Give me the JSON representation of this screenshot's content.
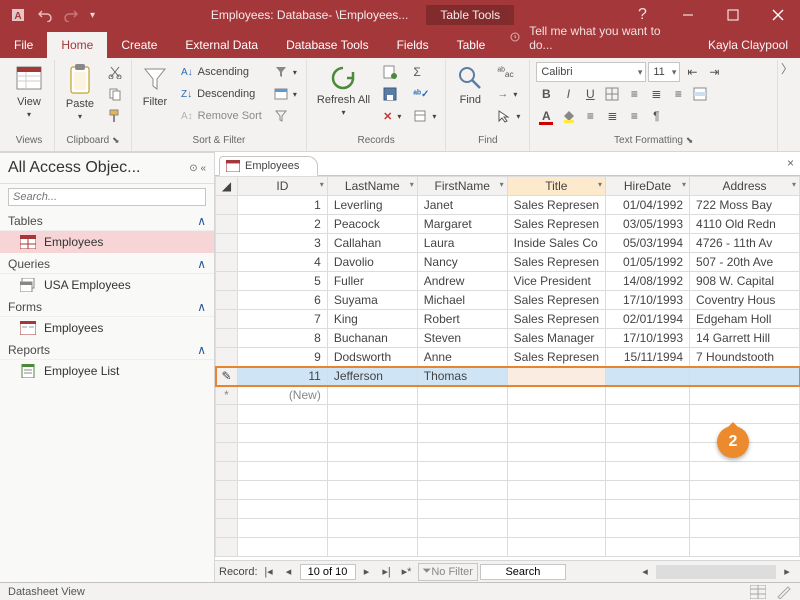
{
  "titlebar": {
    "title": "Employees: Database- \\Employees...",
    "tools_label": "Table Tools",
    "user": "Kayla Claypool"
  },
  "ribbon_tabs": [
    "File",
    "Home",
    "Create",
    "External Data",
    "Database Tools",
    "Fields",
    "Table"
  ],
  "tell_me": "Tell me what you want to do...",
  "groups": {
    "views": "Views",
    "clipboard": "Clipboard",
    "sort_filter": "Sort & Filter",
    "records": "Records",
    "find": "Find",
    "text_formatting": "Text Formatting",
    "view": "View",
    "paste": "Paste",
    "filter": "Filter",
    "ascending": "Ascending",
    "descending": "Descending",
    "remove_sort": "Remove Sort",
    "refresh": "Refresh All",
    "find_btn": "Find"
  },
  "font": {
    "name": "Calibri",
    "size": "11"
  },
  "nav": {
    "title": "All Access Objec...",
    "search_placeholder": "Search...",
    "sections": {
      "tables": "Tables",
      "queries": "Queries",
      "forms": "Forms",
      "reports": "Reports"
    },
    "items": {
      "table_employees": "Employees",
      "query_usa": "USA Employees",
      "form_employees": "Employees",
      "report_list": "Employee List"
    }
  },
  "tab_label": "Employees",
  "columns": {
    "id": "ID",
    "last": "LastName",
    "first": "FirstName",
    "title": "Title",
    "hire": "HireDate",
    "addr": "Address"
  },
  "rows": [
    {
      "id": "1",
      "last": "Leverling",
      "first": "Janet",
      "title": "Sales Represen",
      "hire": "01/04/1992",
      "addr": "722 Moss Bay"
    },
    {
      "id": "2",
      "last": "Peacock",
      "first": "Margaret",
      "title": "Sales Represen",
      "hire": "03/05/1993",
      "addr": "4110 Old Redn"
    },
    {
      "id": "3",
      "last": "Callahan",
      "first": "Laura",
      "title": "Inside Sales Co",
      "hire": "05/03/1994",
      "addr": "4726 - 11th Av"
    },
    {
      "id": "4",
      "last": "Davolio",
      "first": "Nancy",
      "title": "Sales Represen",
      "hire": "01/05/1992",
      "addr": "507 - 20th Ave"
    },
    {
      "id": "5",
      "last": "Fuller",
      "first": "Andrew",
      "title": "Vice President",
      "hire": "14/08/1992",
      "addr": "908 W. Capital"
    },
    {
      "id": "6",
      "last": "Suyama",
      "first": "Michael",
      "title": "Sales Represen",
      "hire": "17/10/1993",
      "addr": "Coventry Hous"
    },
    {
      "id": "7",
      "last": "King",
      "first": "Robert",
      "title": "Sales Represen",
      "hire": "02/01/1994",
      "addr": "Edgeham Holl"
    },
    {
      "id": "8",
      "last": "Buchanan",
      "first": "Steven",
      "title": "Sales Manager",
      "hire": "17/10/1993",
      "addr": "14 Garrett Hill"
    },
    {
      "id": "9",
      "last": "Dodsworth",
      "first": "Anne",
      "title": "Sales Represen",
      "hire": "15/11/1994",
      "addr": "7 Houndstooth"
    },
    {
      "id": "11",
      "last": "Jefferson",
      "first": "Thomas",
      "title": "",
      "hire": "",
      "addr": ""
    }
  ],
  "new_row": "(New)",
  "callout": "2",
  "recnav": {
    "label": "Record:",
    "pos": "10 of 10",
    "nofilter": "No Filter",
    "search": "Search"
  },
  "status": "Datasheet View"
}
